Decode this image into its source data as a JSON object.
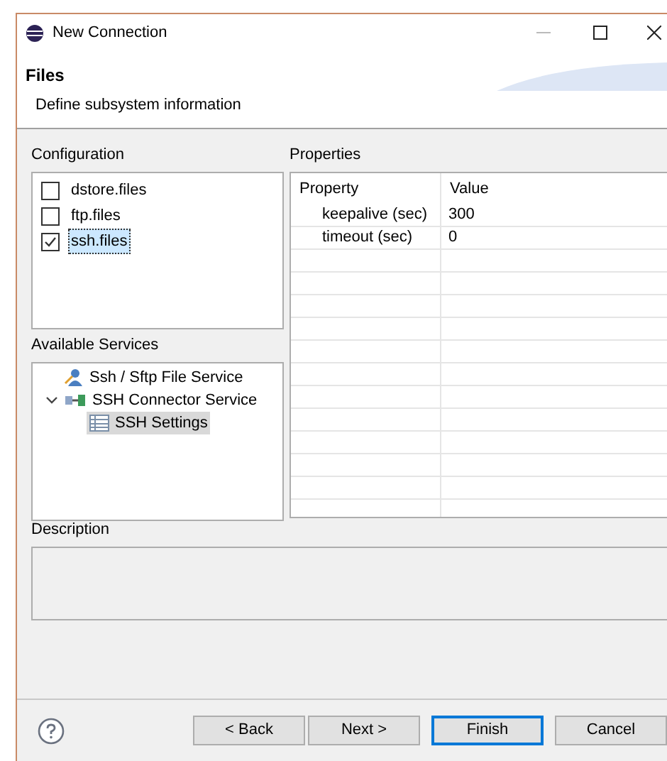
{
  "window": {
    "title": "New Connection"
  },
  "header": {
    "title": "Files",
    "subtitle": "Define subsystem information"
  },
  "configuration": {
    "label": "Configuration",
    "items": [
      {
        "label": "dstore.files",
        "checked": false,
        "selected": false
      },
      {
        "label": "ftp.files",
        "checked": false,
        "selected": false
      },
      {
        "label": "ssh.files",
        "checked": true,
        "selected": true
      }
    ]
  },
  "services": {
    "label": "Available Services",
    "items": [
      {
        "label": "Ssh / Sftp File Service",
        "kind": "service",
        "selected": false
      },
      {
        "label": "SSH Connector Service",
        "kind": "connector",
        "selected": false,
        "expanded": true,
        "children": [
          {
            "label": "SSH Settings",
            "kind": "settings",
            "selected": true
          }
        ]
      }
    ]
  },
  "properties": {
    "label": "Properties",
    "columns": [
      "Property",
      "Value"
    ],
    "rows": [
      [
        "keepalive (sec)",
        "300"
      ],
      [
        "timeout (sec)",
        "0"
      ]
    ]
  },
  "description": {
    "label": "Description"
  },
  "buttons": [
    {
      "label": "< Back",
      "kind": "normal"
    },
    {
      "label": "Next >",
      "kind": "normal"
    },
    {
      "label": "Finish",
      "kind": "default"
    },
    {
      "label": "Cancel",
      "kind": "normal"
    }
  ]
}
